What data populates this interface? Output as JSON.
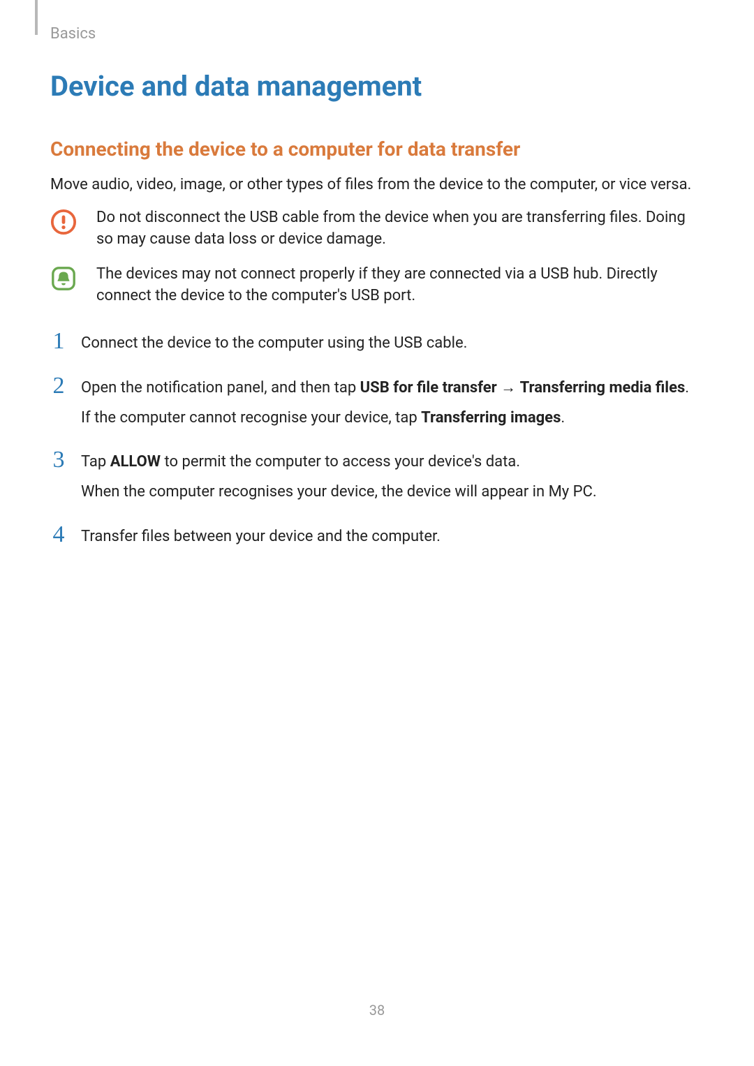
{
  "header": {
    "breadcrumb": "Basics"
  },
  "main": {
    "title": "Device and data management",
    "section_title": "Connecting the device to a computer for data transfer",
    "intro": "Move audio, video, image, or other types of files from the device to the computer, or vice versa.",
    "callouts": [
      {
        "icon": "warning",
        "text": "Do not disconnect the USB cable from the device when you are transferring files. Doing so may cause data loss or device damage."
      },
      {
        "icon": "notice",
        "text": "The devices may not connect properly if they are connected via a USB hub. Directly connect the device to the computer's USB port."
      }
    ],
    "steps": [
      {
        "num": "1",
        "lines": [
          {
            "parts": [
              {
                "t": "Connect the device to the computer using the USB cable."
              }
            ]
          }
        ]
      },
      {
        "num": "2",
        "lines": [
          {
            "parts": [
              {
                "t": "Open the notification panel, and then tap "
              },
              {
                "t": "USB for file transfer",
                "bold": true
              },
              {
                "t": " → "
              },
              {
                "t": "Transferring media files",
                "bold": true
              },
              {
                "t": "."
              }
            ]
          },
          {
            "parts": [
              {
                "t": "If the computer cannot recognise your device, tap "
              },
              {
                "t": "Transferring images",
                "bold": true
              },
              {
                "t": "."
              }
            ]
          }
        ]
      },
      {
        "num": "3",
        "lines": [
          {
            "parts": [
              {
                "t": "Tap "
              },
              {
                "t": "ALLOW",
                "bold": true
              },
              {
                "t": " to permit the computer to access your device's data."
              }
            ]
          },
          {
            "parts": [
              {
                "t": "When the computer recognises your device, the device will appear in My PC."
              }
            ]
          }
        ]
      },
      {
        "num": "4",
        "lines": [
          {
            "parts": [
              {
                "t": "Transfer files between your device and the computer."
              }
            ]
          }
        ]
      }
    ]
  },
  "footer": {
    "page_number": "38"
  },
  "colors": {
    "blue": "#2c7bb6",
    "orange": "#d97a3c",
    "orange_icon": "#e8663c",
    "green_icon": "#6aa84f"
  }
}
